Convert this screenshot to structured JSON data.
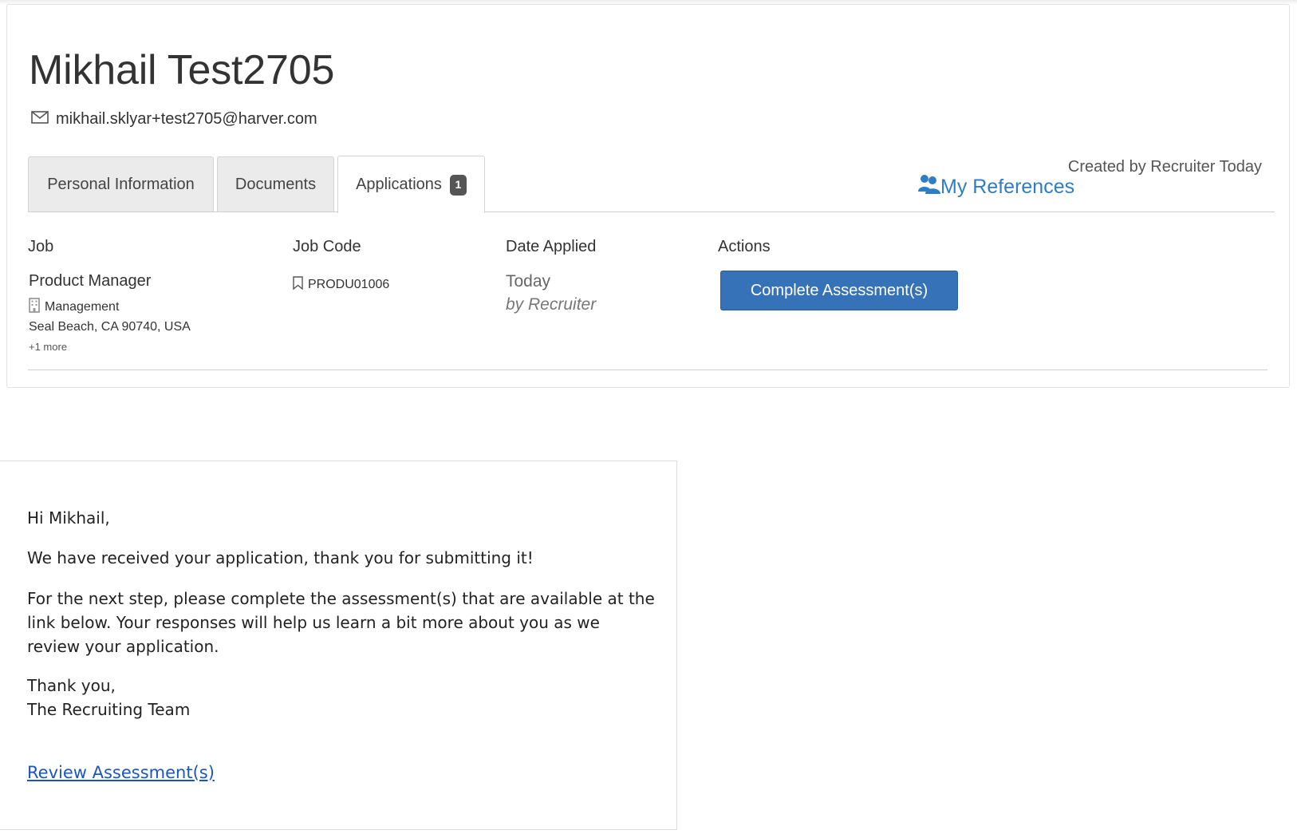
{
  "candidate": {
    "name": "Mikhail Test2705",
    "email": "mikhail.sklyar+test2705@harver.com"
  },
  "tabs": [
    {
      "label": "Personal Information"
    },
    {
      "label": "Documents"
    },
    {
      "label": "Applications",
      "badge": "1",
      "active": true
    }
  ],
  "meta": {
    "created_by": "Created by Recruiter Today",
    "references_link": "My References"
  },
  "applications_table": {
    "headers": [
      "Job",
      "Job Code",
      "Date Applied",
      "Actions"
    ],
    "rows": [
      {
        "job_title": "Product Manager",
        "department": "Management",
        "location": "Seal Beach, CA 90740, USA",
        "more": "+1 more",
        "job_code": "PRODU01006",
        "date_applied": "Today",
        "applied_by": "by Recruiter",
        "action_label": "Complete Assessment(s)"
      }
    ]
  },
  "email_message": {
    "greeting": "Hi Mikhail,",
    "paragraph1": "We have received your application, thank you for submitting it!",
    "paragraph2": "For the next step, please complete the assessment(s) that are available at the link below. Your responses will help us learn a bit more about you as we review your application.",
    "signoff_line1": "Thank you,",
    "signoff_line2": "The Recruiting Team",
    "link_label": "Review Assessment(s)"
  },
  "colors": {
    "primary_button": "#3572b7",
    "link": "#2f7dc4",
    "email_link": "#1a55c7"
  },
  "icons": {
    "email": "envelope-icon",
    "references": "users-icon",
    "department": "building-icon",
    "job_code": "bookmark-icon"
  }
}
